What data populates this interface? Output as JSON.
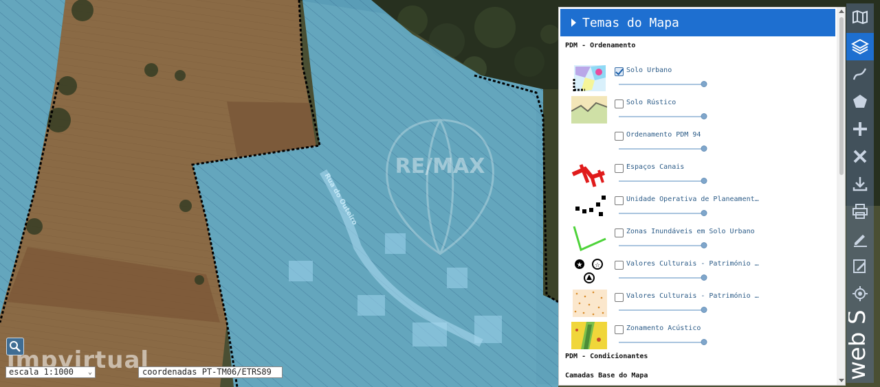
{
  "map": {
    "watermark_text": "RE/MAX",
    "brand_text": "impvirtual",
    "road_label": "Rua do Outeiro",
    "scale_select": "escala 1:1000",
    "coordinates_label": "coordenadas PT-TM06/ETRS89",
    "zone_fill_color": "#6fc8f2",
    "boundary_color": "#000000"
  },
  "panel": {
    "title": "Temas do Mapa",
    "header_color": "#1e6fd0",
    "sections": [
      {
        "title": "PDM - Ordenamento",
        "layers": [
          {
            "label": "Solo Urbano",
            "checked": true,
            "opacity": 1.0,
            "legend_icon": "urban-soil-legend-icon"
          },
          {
            "label": "Solo Rústico",
            "checked": false,
            "opacity": 1.0,
            "legend_icon": "rustic-soil-legend-icon"
          },
          {
            "label": "Ordenamento PDM 94",
            "checked": false,
            "opacity": 1.0,
            "legend_icon": ""
          },
          {
            "label": "Espaços Canais",
            "checked": false,
            "opacity": 1.0,
            "legend_icon": "channel-spaces-legend-icon"
          },
          {
            "label": "Unidade Operativa de Planeament…",
            "checked": false,
            "opacity": 1.0,
            "legend_icon": "operative-unit-legend-icon"
          },
          {
            "label": "Zonas Inundáveis em Solo Urbano",
            "checked": false,
            "opacity": 1.0,
            "legend_icon": "flood-zones-legend-icon"
          },
          {
            "label": "Valores Culturais - Património …",
            "checked": false,
            "opacity": 1.0,
            "legend_icon": "heritage-points-legend-icon"
          },
          {
            "label": "Valores Culturais - Património …",
            "checked": false,
            "opacity": 1.0,
            "legend_icon": "heritage-areas-legend-icon"
          },
          {
            "label": "Zonamento Acústico",
            "checked": false,
            "opacity": 1.0,
            "legend_icon": "acoustic-zoning-legend-icon"
          }
        ]
      },
      {
        "title": "PDM - Condicionantes"
      },
      {
        "title": "Camadas Base do Mapa"
      }
    ]
  },
  "toolbar": {
    "tools": [
      "map-icon",
      "layers-icon",
      "line-measure-icon",
      "polygon-icon",
      "plus-icon",
      "close-icon",
      "download-icon",
      "print-icon",
      "edit-icon",
      "edit-list-icon",
      "locate-icon"
    ],
    "active": "layers-icon",
    "brand": "web SIG"
  }
}
